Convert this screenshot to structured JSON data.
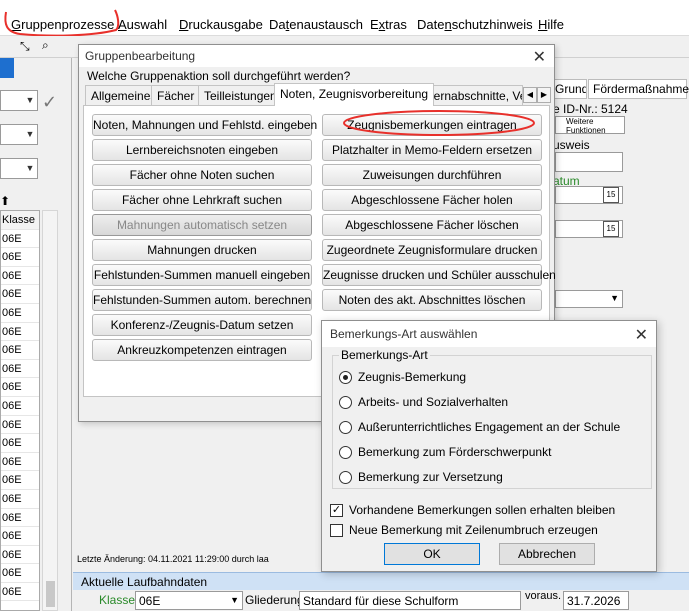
{
  "menu": {
    "items": [
      {
        "label": "Gruppenprozesse",
        "u": "G",
        "rest": "ruppenprozesse"
      },
      {
        "label": "Auswahl",
        "u": "A",
        "rest": "uswahl"
      },
      {
        "label": "Druckausgabe",
        "u": "D",
        "rest": "ruckausgabe"
      },
      {
        "label": "Datenaustausch",
        "pre": "Da",
        "u": "t",
        "rest": "enaustausch"
      },
      {
        "label": "Extras",
        "pre": "E",
        "u": "x",
        "rest": "tras"
      },
      {
        "label": "Datenschutzhinweis",
        "pre": "Date",
        "u": "n",
        "rest": "schutzhinweis"
      },
      {
        "label": "Hilfe",
        "u": "H",
        "rest": "ilfe"
      }
    ],
    "annotation_color": "#e8302b"
  },
  "left_panel": {
    "list_header": "Klasse",
    "list_rows": [
      "06E",
      "06E",
      "06E",
      "06E",
      "06E",
      "06E",
      "06E",
      "06E",
      "06E",
      "06E",
      "06E",
      "06E",
      "06E",
      "06E",
      "06E",
      "06E",
      "06E",
      "06E",
      "06E",
      "06E"
    ]
  },
  "background": {
    "tabs": [
      "Grundinfo",
      "Fördermaßnahmen"
    ],
    "id_label": "e ID-Nr.: 5124",
    "weitere_funktionen": "Weitere Funktionen",
    "ausweis_label": "usweis",
    "datum_label": "atum",
    "status_text": "Letzte Änderung: 04.11.2021 11:29:00 durch laa",
    "laufbahn_title": "Aktuelle Laufbahndaten",
    "klasse_label": "Klasse",
    "klasse_value": "06E",
    "gliederung_label": "Gliederung",
    "gliederung_value": "Standard für diese Schulform",
    "voraus_label": "voraus. Abschl.",
    "voraus_value": "31.7.2026",
    "calendar_text": "15"
  },
  "dialog_group": {
    "title": "Gruppenbearbeitung",
    "question": "Welche Gruppenaktion soll durchgeführt werden?",
    "tabs": [
      "Allgemeines",
      "Fächer",
      "Teilleistungen",
      "Noten, Zeugnisvorbereitung",
      "Lernabschnitte, Ver"
    ],
    "active_tab": 3,
    "left_buttons": [
      {
        "label": "Noten, Mahnungen und Fehlstd. eingeben",
        "enabled": true
      },
      {
        "label": "Lernbereichsnoten eingeben",
        "enabled": true
      },
      {
        "label": "Fächer ohne Noten suchen",
        "enabled": true
      },
      {
        "label": "Fächer ohne Lehrkraft suchen",
        "enabled": true
      },
      {
        "label": "Mahnungen automatisch setzen",
        "enabled": false
      },
      {
        "label": "Mahnungen drucken",
        "enabled": true
      },
      {
        "label": "Fehlstunden-Summen manuell eingeben",
        "enabled": true
      },
      {
        "label": "Fehlstunden-Summen autom. berechnen",
        "enabled": true
      },
      {
        "label": "Konferenz-/Zeugnis-Datum setzen",
        "enabled": true
      },
      {
        "label": "Ankreuzkompetenzen eintragen",
        "enabled": true
      }
    ],
    "right_buttons": [
      {
        "label": "Zeugnisbemerkungen eintragen",
        "enabled": true
      },
      {
        "label": "Platzhalter in Memo-Feldern ersetzen",
        "enabled": true
      },
      {
        "label": "Zuweisungen durchführen",
        "enabled": true
      },
      {
        "label": "Abgeschlossene Fächer holen",
        "enabled": true
      },
      {
        "label": "Abgeschlossene Fächer löschen",
        "enabled": true
      },
      {
        "label": "Zugeordnete Zeugnisformulare drucken",
        "enabled": true
      },
      {
        "label": "Zeugnisse drucken und Schüler ausschulen",
        "enabled": true
      },
      {
        "label": "Noten des akt. Abschnittes löschen",
        "enabled": true
      }
    ]
  },
  "dialog_remark": {
    "title": "Bemerkungs-Art auswählen",
    "group_label": "Bemerkungs-Art",
    "options": [
      {
        "label": "Zeugnis-Bemerkung",
        "selected": true
      },
      {
        "label": "Arbeits- und Sozialverhalten",
        "selected": false
      },
      {
        "label": "Außerunterrichtliches Engagement an der Schule",
        "selected": false
      },
      {
        "label": "Bemerkung zum Förderschwerpunkt",
        "selected": false
      },
      {
        "label": "Bemerkung zur Versetzung",
        "selected": false
      }
    ],
    "checkboxes": [
      {
        "label": "Vorhandene Bemerkungen sollen erhalten bleiben",
        "checked": true
      },
      {
        "label": "Neue Bemerkung mit Zeilenumbruch erzeugen",
        "checked": false
      }
    ],
    "ok_label": "OK",
    "cancel_label": "Abbrechen"
  }
}
